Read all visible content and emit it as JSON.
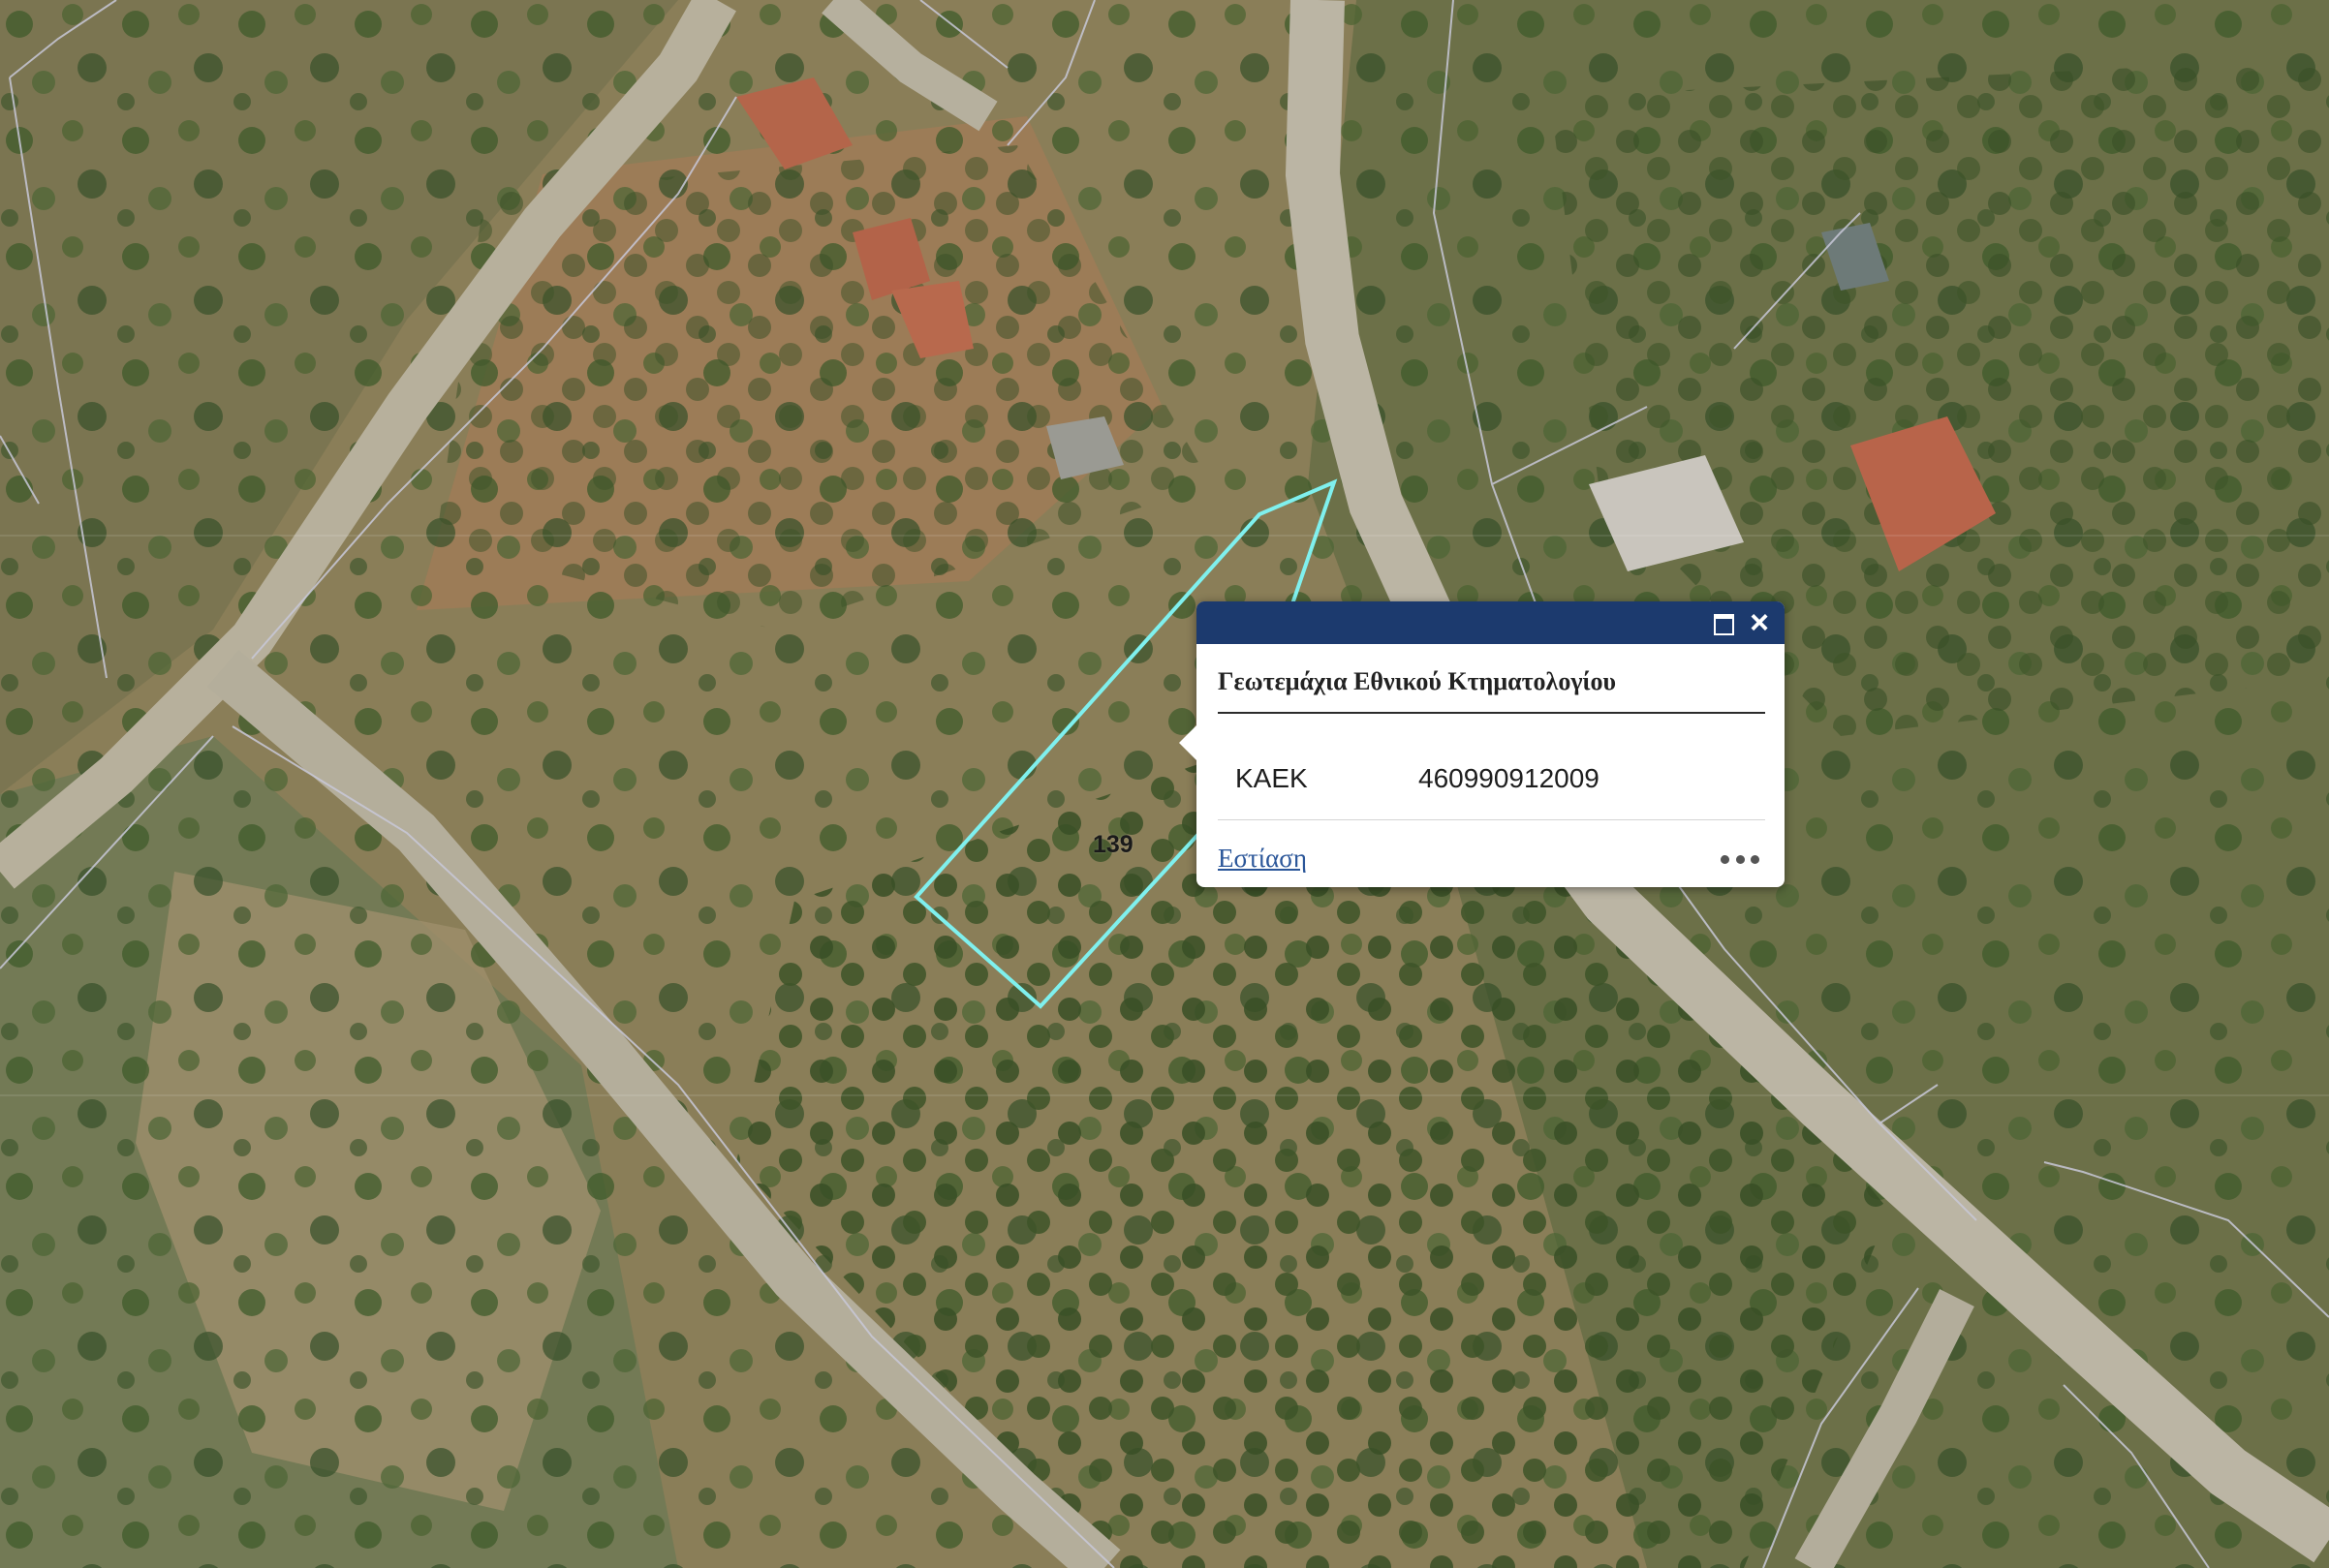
{
  "map": {
    "parcel_number": "139",
    "colors": {
      "selection_outline": "#7ff0ee",
      "parcel_boundary": "#c8c8d8",
      "road": "#b9b3a2",
      "popup_header": "#1c3a6e",
      "link": "#2b5699"
    }
  },
  "popup": {
    "title": "Γεωτεμάχια Εθνικού Κτηματολογίου",
    "attributes": [
      {
        "name": "ΚΑΕΚ",
        "value": "460990912009"
      }
    ],
    "zoom_label": "Εστίαση",
    "icons": {
      "maximize": "maximize-icon",
      "close": "close-icon",
      "more": "more-actions-icon"
    }
  }
}
